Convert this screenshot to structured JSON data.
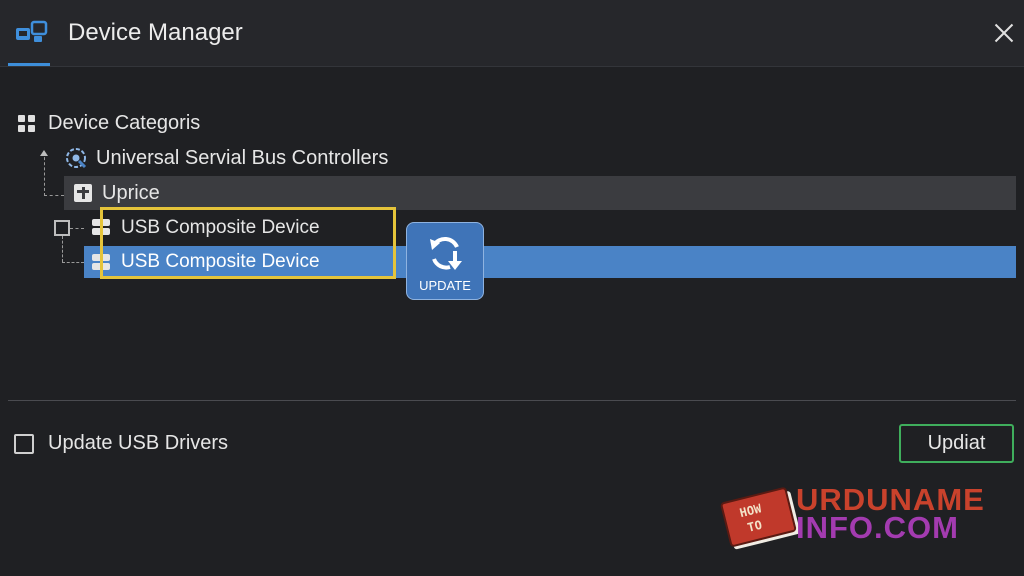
{
  "window": {
    "title": "Device Manager"
  },
  "tree": {
    "root_label": "Device Categoris",
    "category_label": "Universal Servial Bus Controllers",
    "group_label": "Uprice",
    "items": [
      {
        "label": "USB Composite Device",
        "selected": false
      },
      {
        "label": "USB Composite Device",
        "selected": true
      }
    ]
  },
  "update_button": {
    "label": "UPDATE",
    "icon": "refresh-download-icon"
  },
  "footer": {
    "checkbox_label": "Update USB Drivers",
    "checkbox_checked": false,
    "action_label": "Updiat"
  },
  "watermark": {
    "book_text_1": "HOW",
    "book_text_2": "TO",
    "line1": "URDUNAME",
    "line2": "INFO.COM"
  },
  "colors": {
    "accent_blue": "#4a83c6",
    "highlight_yellow": "#e5c43a",
    "button_green": "#3fae5c"
  }
}
